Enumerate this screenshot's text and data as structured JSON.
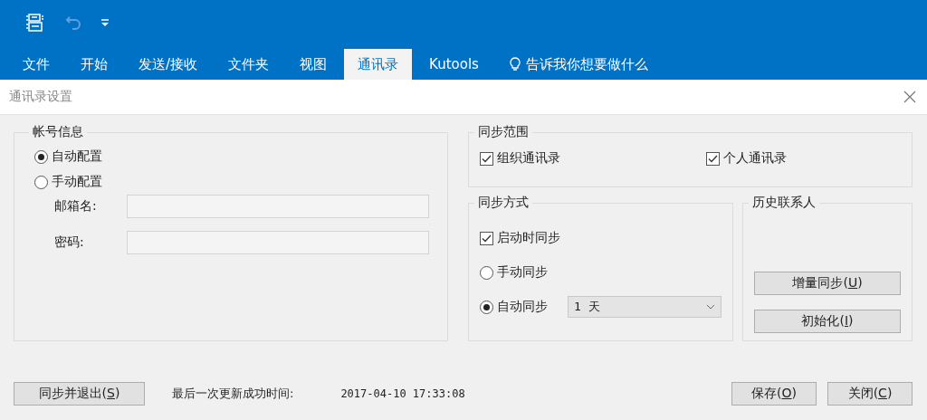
{
  "ribbon": {
    "tabs": [
      {
        "label": "文件",
        "selected": false
      },
      {
        "label": "开始",
        "selected": false
      },
      {
        "label": "发送/接收",
        "selected": false
      },
      {
        "label": "文件夹",
        "selected": false
      },
      {
        "label": "视图",
        "selected": false
      },
      {
        "label": "通讯录",
        "selected": true
      },
      {
        "label": "Kutools",
        "selected": false
      }
    ],
    "tell_me": "告诉我你想要做什么"
  },
  "dialog": {
    "title": "通讯录设置"
  },
  "account": {
    "title": "帐号信息",
    "options": [
      {
        "label": "自动配置",
        "selected": true
      },
      {
        "label": "手动配置",
        "selected": false
      }
    ],
    "fields": [
      {
        "label": "邮箱名:"
      },
      {
        "label": "密码:"
      }
    ]
  },
  "sync_scope": {
    "title": "同步范围",
    "options": [
      {
        "label": "组织通讯录",
        "checked": true
      },
      {
        "label": "个人通讯录",
        "checked": true
      }
    ]
  },
  "sync_method": {
    "title": "同步方式",
    "on_start": {
      "label": "启动时同步",
      "checked": true
    },
    "modes": [
      {
        "label": "手动同步",
        "selected": false
      },
      {
        "label": "自动同步",
        "selected": true
      }
    ],
    "interval": "1 天"
  },
  "history": {
    "title": "历史联系人",
    "buttons": [
      {
        "pre": "增量同步(",
        "key": "U",
        "post": ")"
      },
      {
        "pre": "初始化(",
        "key": "I",
        "post": ")"
      }
    ]
  },
  "footer": {
    "sync_exit": {
      "pre": "同步并退出(",
      "key": "S",
      "post": ")"
    },
    "last_update_label": "最后一次更新成功时间:",
    "last_update": "2017-04-10 17:33:08",
    "buttons": [
      {
        "pre": "保存(",
        "key": "O",
        "post": ")"
      },
      {
        "pre": "关闭(",
        "key": "C",
        "post": ")"
      }
    ]
  }
}
